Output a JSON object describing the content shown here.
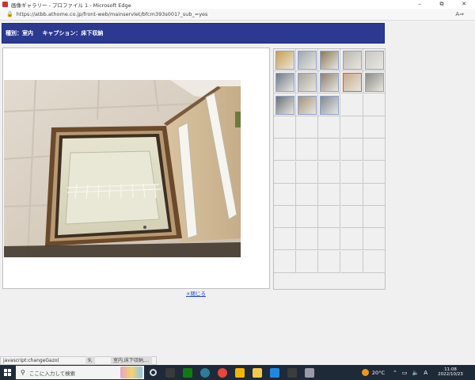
{
  "window": {
    "title": "画像ギャラリー - プロファイル 1 - Microsoft Edge",
    "controls": [
      "–",
      "⧉",
      "✕"
    ]
  },
  "address_bar": {
    "url": "https://atbb.athome.co.jp/front-web/mainservlet/bfcm393s001?_sub_=yes"
  },
  "header": {
    "category": "種別：室内",
    "caption": "キャプション：床下収納"
  },
  "main": {
    "close_link": "×閉じる"
  },
  "thumbnails": {
    "count": 13,
    "selected_index": 8,
    "colors": [
      "#c9a04a",
      "#9fa8b0",
      "#8a7a5a",
      "#b8b8b0",
      "#c8c8c2",
      "#6d7a88",
      "#a8a49a",
      "#8c8070",
      "#caa98c",
      "#8a8c86",
      "#6a7078",
      "#a4927a",
      "#7e8a94"
    ]
  },
  "status": {
    "link_text": "javascript:changeGazo(",
    "tooltip_mid": "9,",
    "tooltip_right": "室内,床下収納,..."
  },
  "taskbar": {
    "search_placeholder": "ここに入力して検索",
    "weather_temp": "20°C",
    "ime": "A",
    "time": "11:08",
    "date": "2022/10/23",
    "app_colors": [
      "#5a5a5a",
      "#3a3a3a",
      "#107c10",
      "#2d7d9a",
      "#e8453c",
      "#f4b400",
      "#f2c94c",
      "#1e88e5",
      "#3c3c3c",
      "#9a9aa8"
    ]
  }
}
